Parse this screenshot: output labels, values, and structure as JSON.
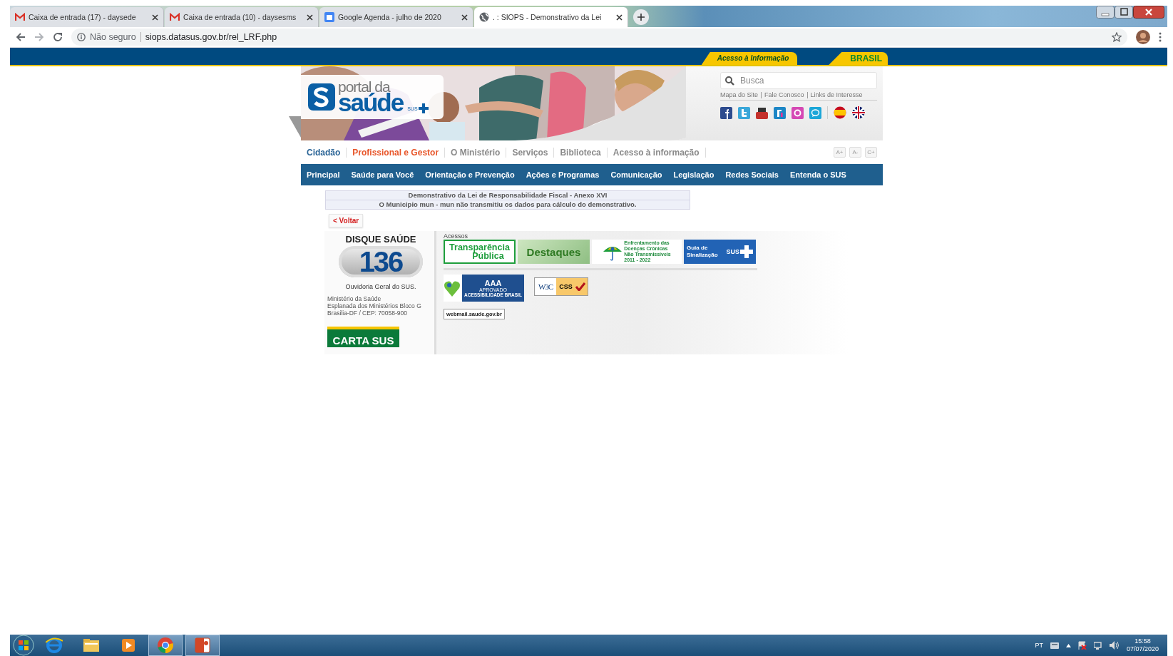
{
  "browser": {
    "tabs": [
      {
        "kind": "mail",
        "title": "Caixa de entrada (17) - daysede",
        "selected": false
      },
      {
        "kind": "mail",
        "title": "Caixa de entrada (10) - daysesms",
        "selected": false
      },
      {
        "kind": "calendar",
        "title": "Google Agenda - julho de 2020",
        "selected": false
      },
      {
        "kind": "globe",
        "title": ". : SIOPS - Demonstrativo da Lei",
        "selected": true
      }
    ],
    "security": "Não seguro",
    "url": "siops.datasus.gov.br/rel_LRF.php"
  },
  "gov_bar": {
    "links": [
      "Acesso à Informação",
      "BRASIL"
    ]
  },
  "site": {
    "logo": {
      "line1": "portal da",
      "line2": "saúde",
      "badge": "SUS"
    },
    "search": {
      "placeholder": "Busca"
    },
    "utility_links": [
      "Mapa do Site",
      "Fale Conosco",
      "Links de Interesse"
    ],
    "nav_primary": [
      {
        "label": "Cidadão",
        "color": "#2a6496"
      },
      {
        "label": "Profissional e Gestor",
        "color": "#e8562a"
      },
      {
        "label": "O Ministério",
        "color": "#8a8a8a"
      },
      {
        "label": "Serviços",
        "color": "#8a8a8a"
      },
      {
        "label": "Biblioteca",
        "color": "#8a8a8a"
      },
      {
        "label": "Acesso à informação",
        "color": "#8a8a8a"
      }
    ],
    "font_buttons": [
      "A+",
      "A-",
      "C+"
    ],
    "nav_secondary": [
      "Principal",
      "Saúde para Você",
      "Orientação e Prevenção",
      "Ações e Programas",
      "Comunicação",
      "Legislação",
      "Redes Sociais",
      "Entenda o SUS"
    ]
  },
  "report": {
    "rows": [
      "Demonstrativo da Lei de Responsabilidade Fiscal - Anexo XVI",
      "O Municipio mun - mun não transmitiu os dados para cálculo do demonstrativo."
    ],
    "back_button": "< Voltar"
  },
  "footer": {
    "disque": {
      "title": "DISQUE SAÚDE",
      "number": "136",
      "caption": "Ouvidoria Geral do SUS."
    },
    "address": [
      "Ministério da Saúde",
      "Esplanada dos Ministérios Bloco G",
      "Brasilia-DF / CEP: 70058-900"
    ],
    "carta": "CARTA SUS",
    "acessos_label": "Acessos",
    "banners": [
      {
        "kind": "transparencia",
        "lines": [
          "Transparência",
          "Pública"
        ]
      },
      {
        "kind": "destaques",
        "lines": [
          "Destaques"
        ]
      },
      {
        "kind": "cronicas",
        "lines": [
          "Enfrentamento das",
          "Doenças Crônicas",
          "Não Transmissíveis",
          "2011 - 2022"
        ]
      },
      {
        "kind": "guia",
        "lines": [
          "Guia de",
          "Sinalização",
          "SUS"
        ]
      }
    ],
    "badges": [
      {
        "kind": "acessibilidade",
        "lines": [
          "AAA",
          "APROVADO",
          "ACESSIBILIDADE BRASIL"
        ]
      },
      {
        "kind": "w3c",
        "lines": [
          "W3C",
          "CSS"
        ]
      }
    ],
    "webmail": "webmail.saude.gov.br"
  },
  "taskbar": {
    "language": "PT",
    "time": "15:58",
    "date": "07/07/2020"
  }
}
